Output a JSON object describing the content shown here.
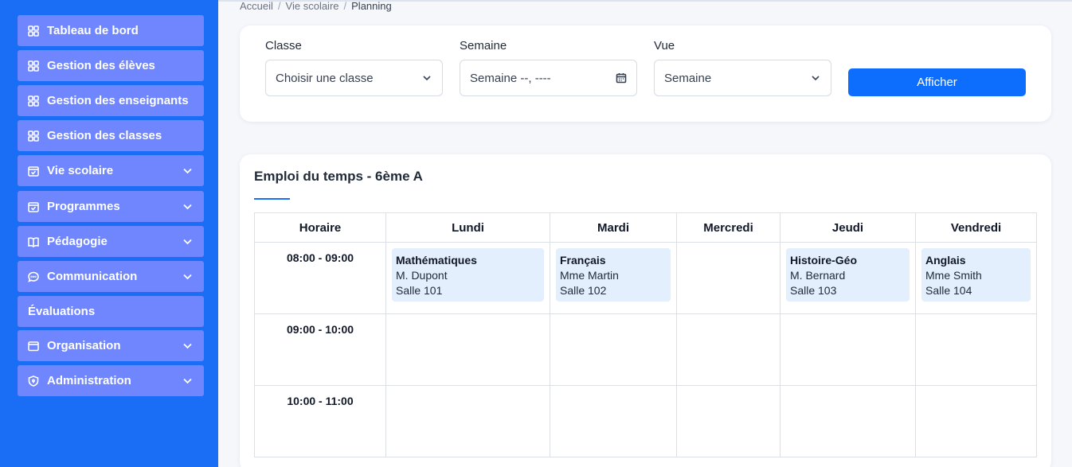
{
  "sidebar": {
    "items": [
      {
        "label": "Tableau de bord",
        "icon": "grid-icon",
        "expandable": false
      },
      {
        "label": "Gestion des élèves",
        "icon": "grid-icon",
        "expandable": false
      },
      {
        "label": "Gestion des enseignants",
        "icon": "grid-icon",
        "expandable": false
      },
      {
        "label": "Gestion des classes",
        "icon": "grid-icon",
        "expandable": false
      },
      {
        "label": "Vie scolaire",
        "icon": "calendar-check-icon",
        "expandable": true
      },
      {
        "label": "Programmes",
        "icon": "calendar-check-icon",
        "expandable": true
      },
      {
        "label": "Pédagogie",
        "icon": "book-icon",
        "expandable": true
      },
      {
        "label": "Communication",
        "icon": "chat-icon",
        "expandable": true
      },
      {
        "label": "Évaluations",
        "icon": "",
        "expandable": false
      },
      {
        "label": "Organisation",
        "icon": "window-icon",
        "expandable": true
      },
      {
        "label": "Administration",
        "icon": "shield-icon",
        "expandable": true
      }
    ]
  },
  "breadcrumb": {
    "items": [
      "Accueil",
      "Vie scolaire",
      "Planning"
    ]
  },
  "filters": {
    "classe_label": "Classe",
    "classe_value": "Choisir une classe",
    "semaine_label": "Semaine",
    "semaine_value": "Semaine --, ----",
    "vue_label": "Vue",
    "vue_value": "Semaine",
    "submit_label": "Afficher"
  },
  "timetable": {
    "title": "Emploi du temps - 6ème A",
    "headers": [
      "Horaire",
      "Lundi",
      "Mardi",
      "Mercredi",
      "Jeudi",
      "Vendredi"
    ],
    "rows": [
      {
        "time": "08:00 - 09:00",
        "cells": [
          {
            "subject": "Mathématiques",
            "teacher": "M. Dupont",
            "room": "Salle 101"
          },
          {
            "subject": "Français",
            "teacher": "Mme Martin",
            "room": "Salle 102"
          },
          null,
          {
            "subject": "Histoire-Géo",
            "teacher": "M. Bernard",
            "room": "Salle 103"
          },
          {
            "subject": "Anglais",
            "teacher": "Mme Smith",
            "room": "Salle 104"
          }
        ]
      },
      {
        "time": "09:00 - 10:00",
        "cells": [
          null,
          null,
          null,
          null,
          null
        ]
      },
      {
        "time": "10:00 - 11:00",
        "cells": [
          null,
          null,
          null,
          null,
          null
        ]
      }
    ]
  },
  "colors": {
    "sidebar_bg": "#1a6ef6",
    "nav_item_bg": "#6f86ff",
    "primary_button": "#0d6efd",
    "lesson_bg": "#e3effc"
  }
}
